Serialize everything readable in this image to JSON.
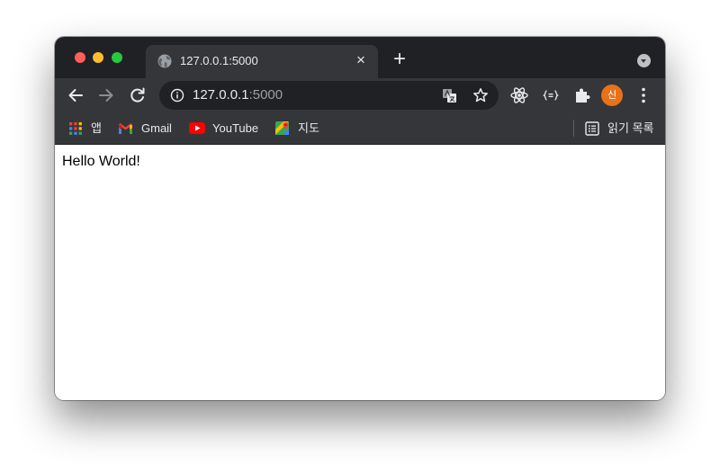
{
  "tab": {
    "title": "127.0.0.1:5000",
    "close_glyph": "×"
  },
  "newtab_glyph": "+",
  "omnibox": {
    "host": "127.0.0.1",
    "port": ":5000"
  },
  "profile": {
    "initial": "신",
    "color": "#e8711a"
  },
  "bookmarks": {
    "apps": "앱",
    "gmail": "Gmail",
    "youtube": "YouTube",
    "maps": "지도",
    "reading_list": "읽기 목록"
  },
  "page": {
    "text": "Hello World!"
  },
  "colors": {
    "titlebar": "#202124",
    "toolbar": "#35363a",
    "text": "#e8eaed"
  }
}
